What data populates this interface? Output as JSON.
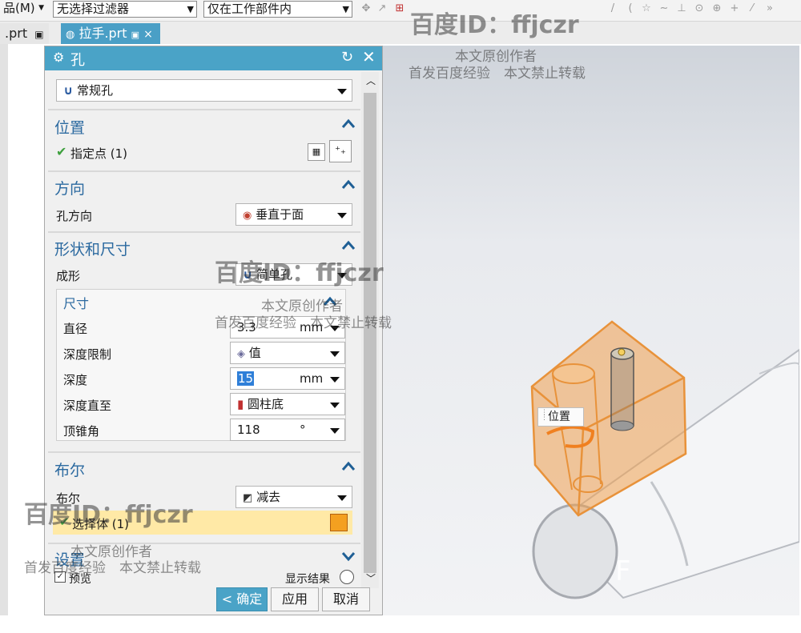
{
  "toolbar": {
    "menu_fragment": "品(M)",
    "filter_combo": "无选择过滤器",
    "scope_combo": "仅在工作部件内"
  },
  "tabs": [
    {
      "label": ".prt"
    },
    {
      "label": "拉手.prt"
    }
  ],
  "dialog": {
    "title": "孔",
    "type_value": "常规孔",
    "sections": {
      "position": {
        "label": "位置",
        "specify_point": "指定点 (1)"
      },
      "direction": {
        "label": "方向",
        "hole_direction_label": "孔方向",
        "hole_direction_value": "垂直于面"
      },
      "shape": {
        "label": "形状和尺寸",
        "form_label": "成形",
        "form_value": "简单孔"
      },
      "dimensions": {
        "label": "尺寸",
        "diameter_label": "直径",
        "diameter_value": "3.3",
        "diameter_unit": "mm",
        "depth_limit_label": "深度限制",
        "depth_limit_value": "值",
        "depth_label": "深度",
        "depth_value": "15",
        "depth_unit": "mm",
        "depth_to_label": "深度直至",
        "depth_to_value": "圆柱底",
        "tip_angle_label": "顶锥角",
        "tip_angle_value": "118",
        "tip_angle_unit": "°"
      },
      "boolean": {
        "label": "布尔",
        "bool_label": "布尔",
        "bool_value": "减去",
        "select_body": "选择体 (1)"
      },
      "settings": {
        "label": "设置",
        "preview_label": "预览",
        "show_result": "显示结果"
      }
    },
    "buttons": {
      "ok": "< 确定 >",
      "apply": "应用",
      "cancel": "取消"
    }
  },
  "viewport": {
    "tooltip": "位置"
  },
  "watermarks": {
    "id_text": "百度ID：ffjczr",
    "line1": "本文原创作者",
    "line2": "首发百度经验　本文禁止转载"
  },
  "colors": {
    "title_bar": "#4aa3c7",
    "section_label": "#2c6aa0",
    "highlight": "#ffe9a6",
    "part_orange": "#f0a050"
  }
}
